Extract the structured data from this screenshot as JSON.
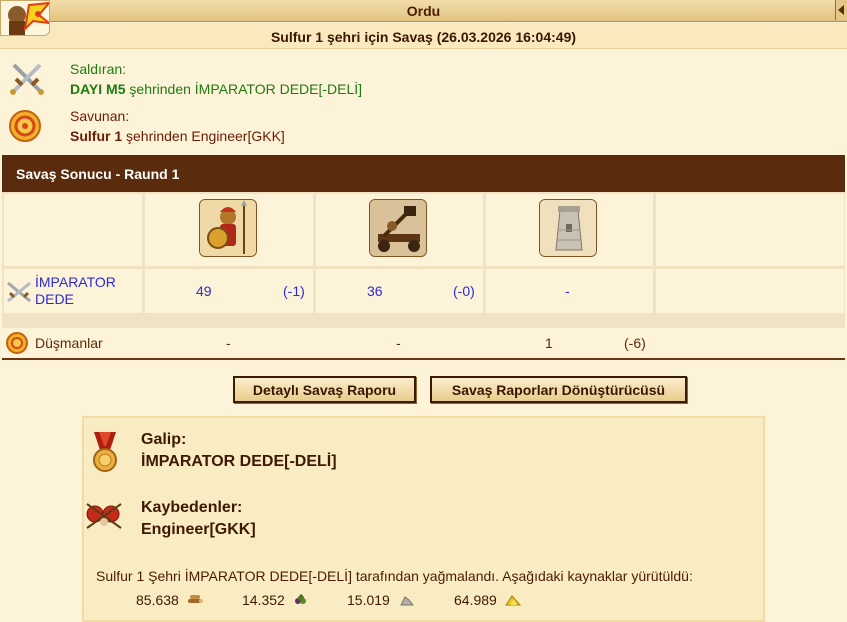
{
  "window": {
    "title": "Ordu"
  },
  "report": {
    "title": "Sulfur 1 şehri için Savaş (26.03.2026 16:04:49)"
  },
  "attacker": {
    "role_label": "Saldıran:",
    "city": "DAYI M5",
    "from_text": " şehrinden ",
    "player": "İMPARATOR DEDE[-DELİ]"
  },
  "defender": {
    "role_label": "Savunan:",
    "city": "Sulfur 1",
    "from_text": " şehrinden ",
    "player": "Engineer[GKK]"
  },
  "result": {
    "header": "Savaş Sonucu - Raund 1",
    "attacker_row": {
      "label_line1": "İMPARATOR",
      "label_line2": "DEDE",
      "cells": [
        {
          "count": "49",
          "loss": "(-1)"
        },
        {
          "count": "36",
          "loss": "(-0)"
        },
        {
          "count": "-",
          "loss": ""
        }
      ]
    },
    "enemy_row": {
      "label": "Düşmanlar",
      "cells": [
        {
          "count": "-",
          "loss": ""
        },
        {
          "count": "-",
          "loss": ""
        },
        {
          "count": "1",
          "loss": "(-6)"
        }
      ]
    },
    "unit_icons": [
      "hoplite-icon",
      "catapult-icon",
      "wall-tower-icon"
    ]
  },
  "buttons": {
    "detailed_report": "Detaylı Savaş Raporu",
    "report_converter": "Savaş Raporları Dönüştürücüsü"
  },
  "summary": {
    "winner_label": "Galip:",
    "winner_name": "İMPARATOR DEDE[-DELİ]",
    "losers_label": "Kaybedenler:",
    "losers_name": "Engineer[GKK]",
    "plunder_text": "Sulfur 1 Şehri İMPARATOR DEDE[-DELİ] tarafından yağmalandı. Aşağıdaki kaynaklar yürütüldü:",
    "resources": [
      {
        "icon": "wood-icon",
        "amount": "85.638"
      },
      {
        "icon": "wine-icon",
        "amount": "14.352"
      },
      {
        "icon": "marble-icon",
        "amount": "15.019"
      },
      {
        "icon": "sulfur-icon",
        "amount": "64.989"
      }
    ]
  },
  "colors": {
    "header_bg": "#5a2b0c",
    "attacker_text": "#1f7a12",
    "link_blue": "#2c2cd0",
    "panel_bg": "#fdf3d8"
  }
}
